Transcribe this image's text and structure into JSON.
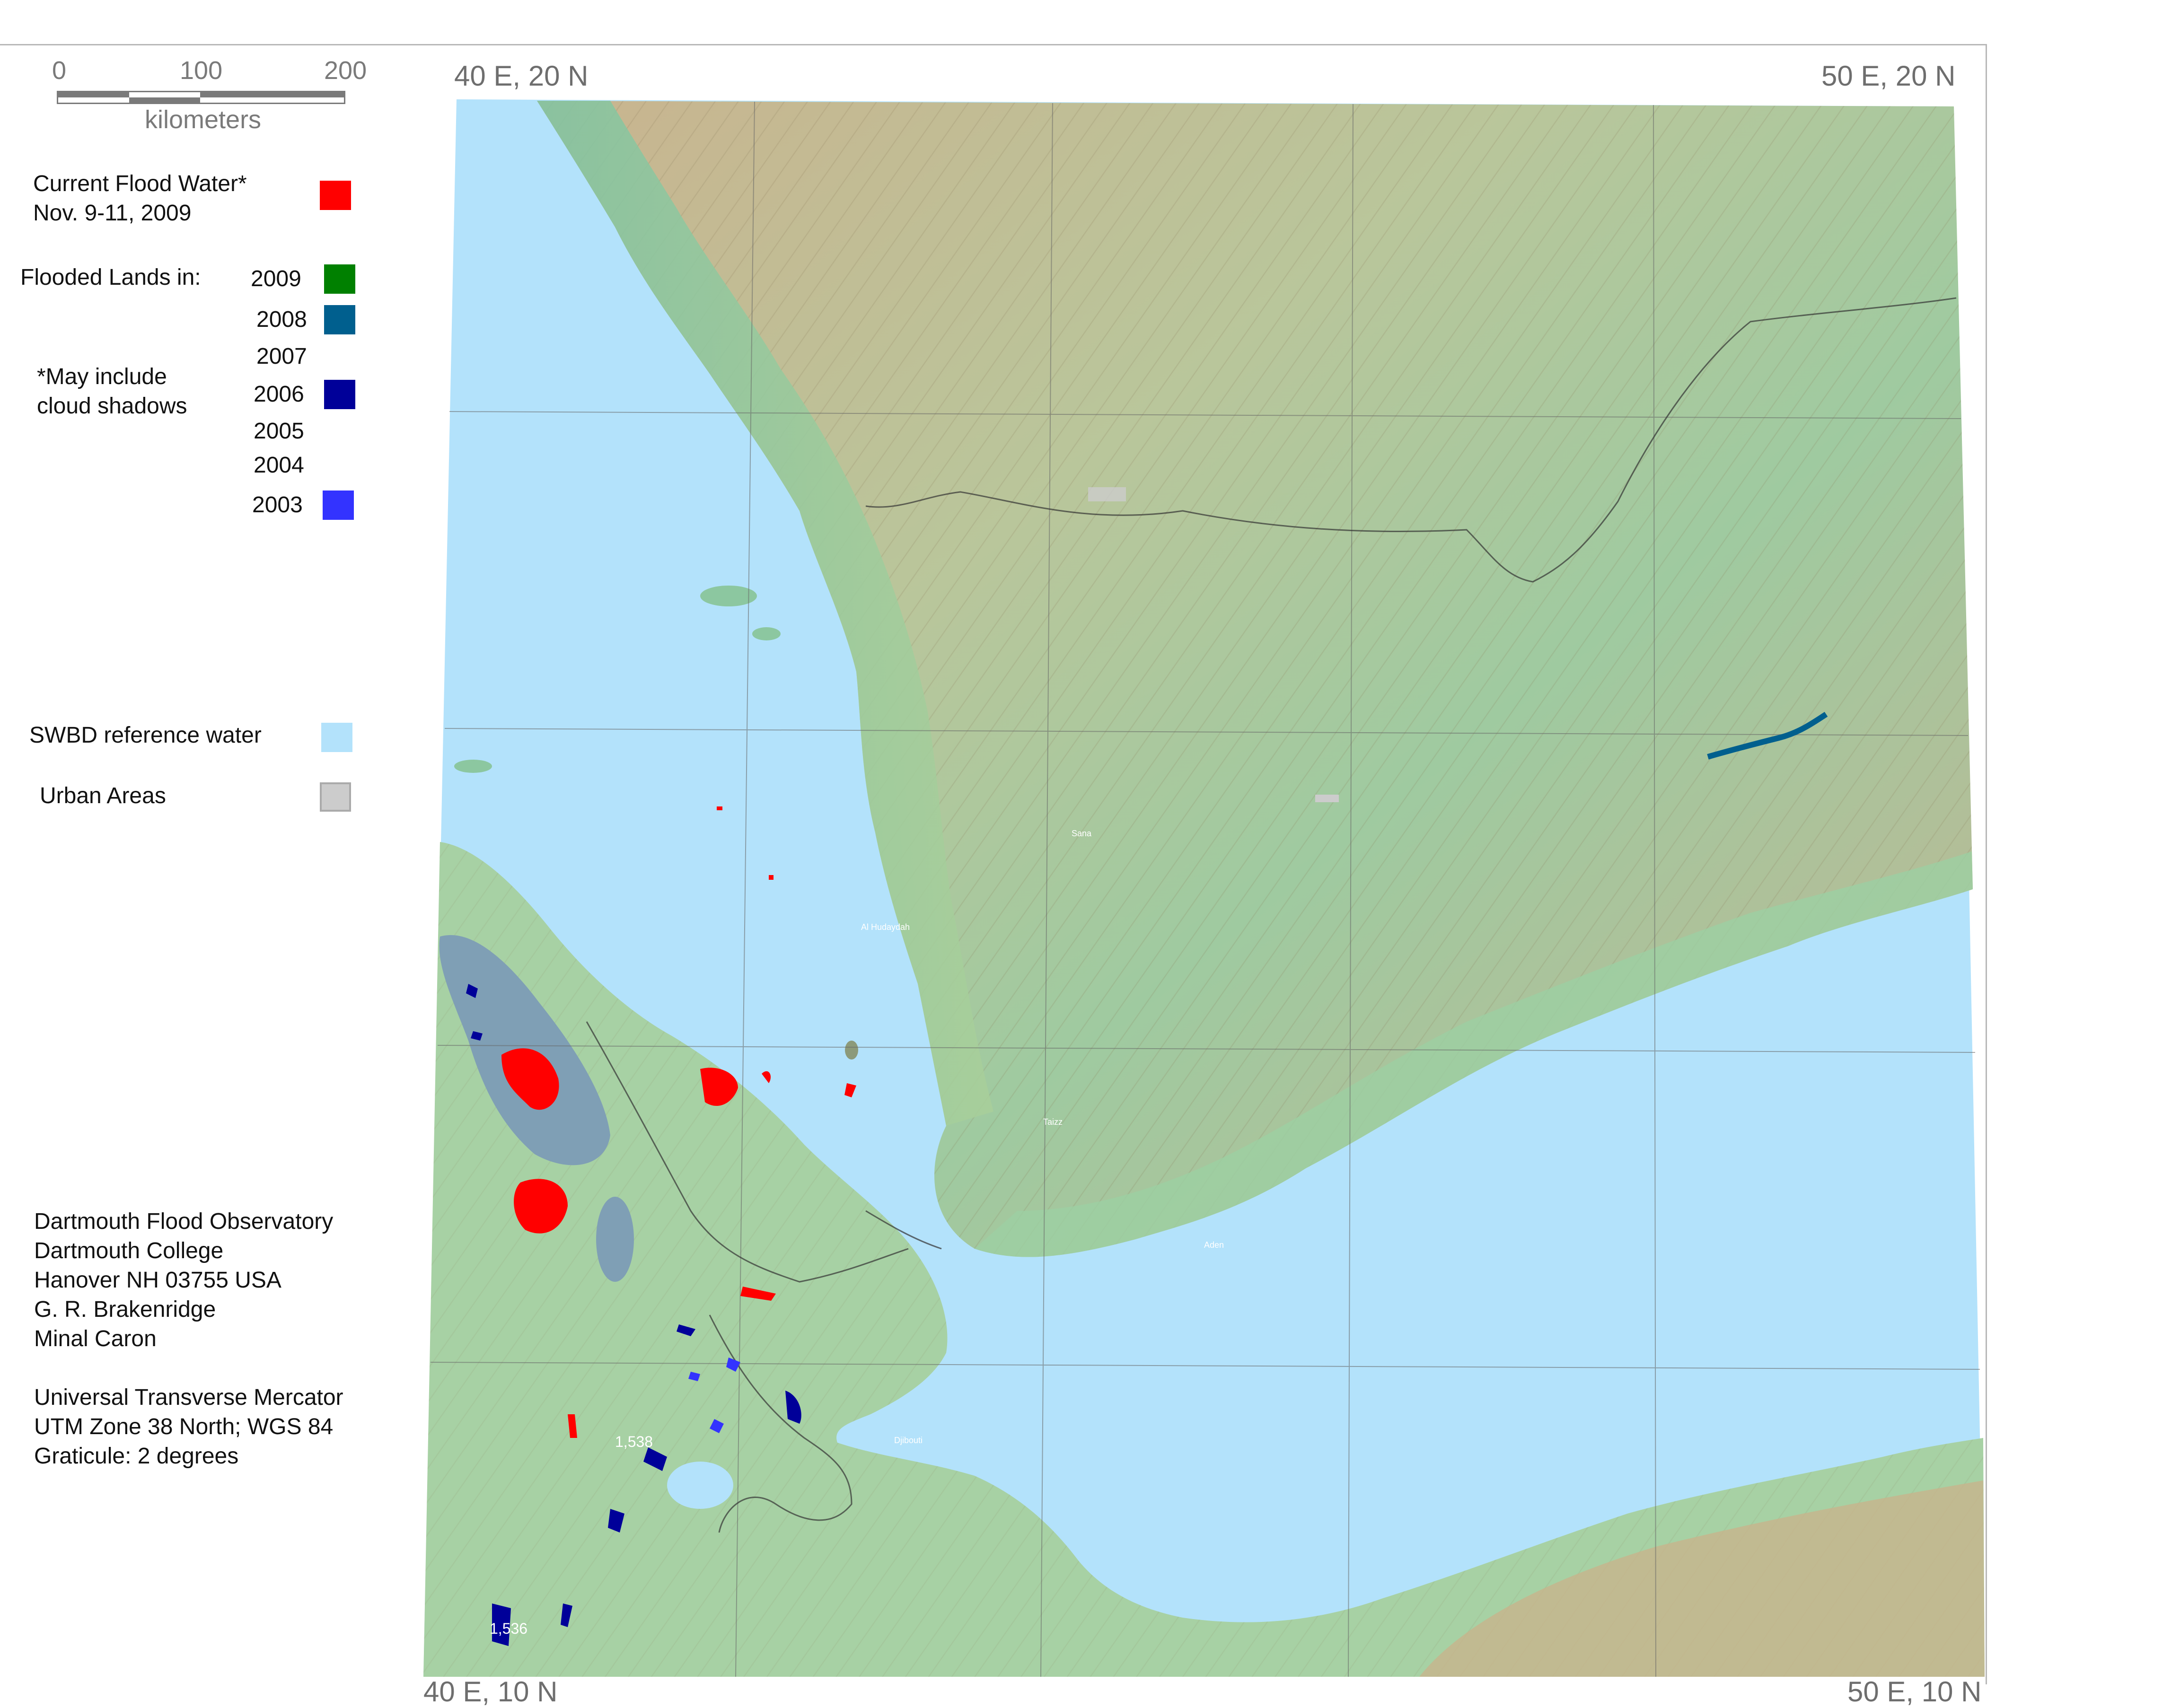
{
  "scale": {
    "ticks": [
      "0",
      "100",
      "200"
    ],
    "unit": "kilometers"
  },
  "legend": {
    "current_flood_line1": "Current Flood Water*",
    "current_flood_line2": "Nov. 9-11, 2009",
    "flooded_lands_label": "Flooded Lands in:",
    "note_line1": "*May include",
    "note_line2": "cloud shadows",
    "years": [
      "2009",
      "2008",
      "2007",
      "2006",
      "2005",
      "2004",
      "2003"
    ],
    "swbd_label": "SWBD reference water",
    "urban_label": "Urban Areas"
  },
  "colors": {
    "current_flood": "#ff0000",
    "y2009": "#008000",
    "y2008": "#005f8e",
    "y2006": "#000099",
    "y2003": "#3333ff",
    "swbd_water": "#b3e2fb",
    "urban": "#cccccc"
  },
  "map": {
    "corner_nw": "40 E, 20 N",
    "corner_ne": "50 E, 20 N",
    "corner_sw": "40 E, 10 N",
    "corner_se": "50 E, 10 N",
    "cities": {
      "sana": "Sana",
      "hudaydah": "Al Hudaydah",
      "taizz": "Taizz",
      "aden": "Aden",
      "djibouti": "Djibouti"
    },
    "elevations": [
      "1,538",
      "1,536"
    ]
  },
  "credits": {
    "lines": [
      "Dartmouth Flood Observatory",
      "Dartmouth College",
      "Hanover NH 03755 USA",
      "G. R. Brakenridge",
      "Minal Caron",
      "",
      "Universal Transverse Mercator",
      "UTM Zone 38 North; WGS 84",
      "Graticule:  2 degrees"
    ]
  }
}
